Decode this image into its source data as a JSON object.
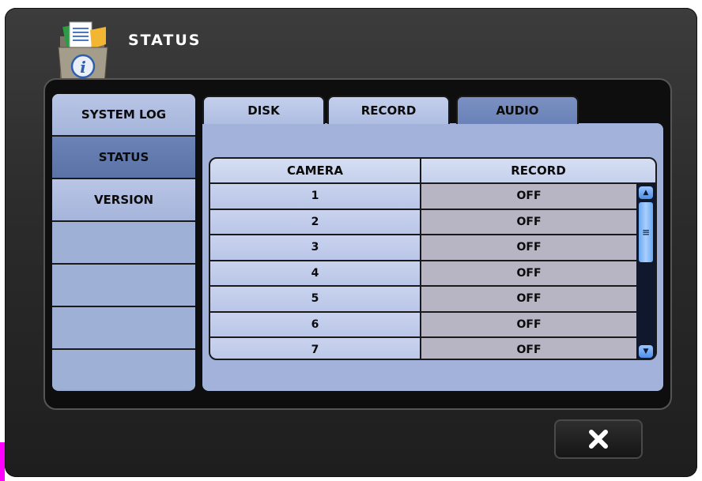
{
  "window": {
    "title": "STATUS"
  },
  "sidebar": {
    "items": [
      {
        "label": "SYSTEM LOG",
        "active": false
      },
      {
        "label": "STATUS",
        "active": true
      },
      {
        "label": "VERSION",
        "active": false
      }
    ]
  },
  "tabs": [
    {
      "label": "DISK",
      "active": false
    },
    {
      "label": "RECORD",
      "active": false
    },
    {
      "label": "AUDIO",
      "active": true
    }
  ],
  "table": {
    "columns": [
      "CAMERA",
      "RECORD"
    ],
    "rows": [
      {
        "camera": "1",
        "record": "OFF"
      },
      {
        "camera": "2",
        "record": "OFF"
      },
      {
        "camera": "3",
        "record": "OFF"
      },
      {
        "camera": "4",
        "record": "OFF"
      },
      {
        "camera": "5",
        "record": "OFF"
      },
      {
        "camera": "6",
        "record": "OFF"
      },
      {
        "camera": "7",
        "record": "OFF"
      }
    ]
  },
  "scrollbar": {
    "up_icon": "arrow-up-icon",
    "down_icon": "arrow-down-icon",
    "thumb_icon": "grip-icon"
  },
  "close_button": {
    "icon": "close-icon"
  },
  "colors": {
    "active_tab": "#6a82b8",
    "record_cell": "#b7b4c4",
    "scroll_accent": "#4d8fe6"
  }
}
